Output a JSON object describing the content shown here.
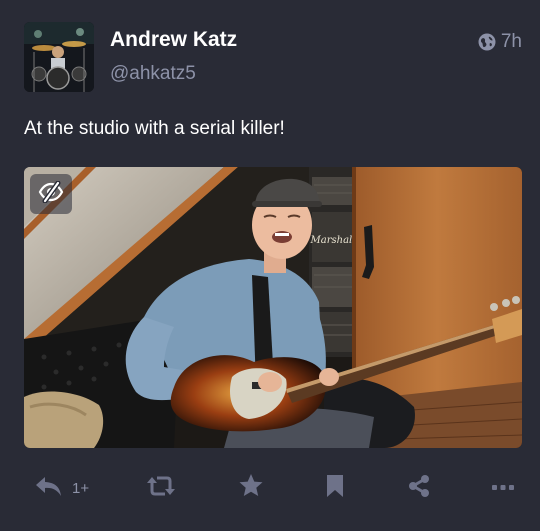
{
  "post": {
    "author": {
      "display_name": "Andrew Katz",
      "handle": "@ahkatz5",
      "avatar_icon": "avatar-drummer-photo"
    },
    "visibility_icon": "globe-icon",
    "relative_time": "7h",
    "content": "At the studio with a serial killer!",
    "media": {
      "kind": "photo",
      "hide_icon": "eye-slash-icon",
      "amp_badge": "Marshall"
    },
    "actions": {
      "reply": {
        "icon": "reply-icon",
        "count": "1+"
      },
      "boost": {
        "icon": "boost-icon"
      },
      "favourite": {
        "icon": "star-icon"
      },
      "bookmark": {
        "icon": "bookmark-icon"
      },
      "share": {
        "icon": "share-icon"
      },
      "more": {
        "icon": "more-icon"
      }
    }
  },
  "colors": {
    "background": "#292b36",
    "text": "#ffffff",
    "muted": "#8d92a8",
    "icon": "#6e7289"
  }
}
